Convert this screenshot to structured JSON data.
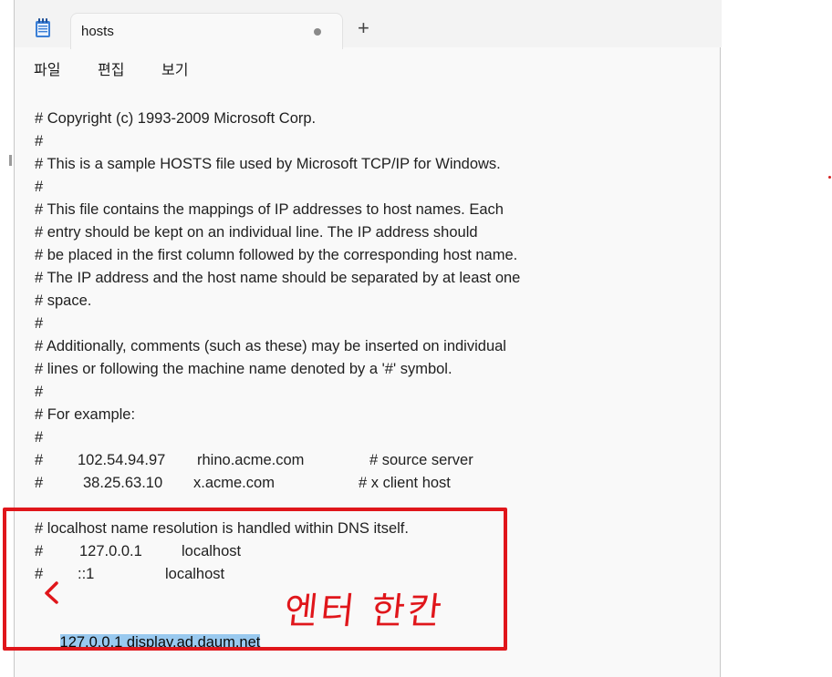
{
  "window": {
    "tab": {
      "title": "hosts",
      "new_tab_glyph": "+",
      "unsaved_indicator": "dot"
    },
    "app_icon": "notepad-icon"
  },
  "menu": {
    "items": [
      {
        "label": "파일"
      },
      {
        "label": "편집"
      },
      {
        "label": "보기"
      }
    ]
  },
  "editor": {
    "lines": [
      "# Copyright (c) 1993-2009 Microsoft Corp.",
      "#",
      "# This is a sample HOSTS file used by Microsoft TCP/IP for Windows.",
      "#",
      "# This file contains the mappings of IP addresses to host names. Each",
      "# entry should be kept on an individual line. The IP address should",
      "# be placed in the first column followed by the corresponding host name.",
      "# The IP address and the host name should be separated by at least one",
      "# space.",
      "#",
      "# Additionally, comments (such as these) may be inserted on individual",
      "# lines or following the machine name denoted by a '#' symbol.",
      "#",
      "# For example:",
      "#"
    ],
    "example1": {
      "hash": "#",
      "ip": "102.54.94.97",
      "host": "rhino.acme.com",
      "comment": "# source server"
    },
    "example2": {
      "hash": "#",
      "ip": "38.25.63.10",
      "host": "x.acme.com",
      "comment": "# x client host"
    },
    "localhost_comment": "# localhost name resolution is handled within DNS itself.",
    "lh1": {
      "hash": "#",
      "ip": "127.0.0.1",
      "host": "localhost"
    },
    "lh2": {
      "hash": "#",
      "ip": "::1",
      "host": "localhost"
    },
    "selected_line": "127.0.0.1 display.ad.daum.net"
  },
  "annotation": {
    "text": "엔터 한칸",
    "color": "#e0161b",
    "selection_color": "#99c9ef"
  }
}
